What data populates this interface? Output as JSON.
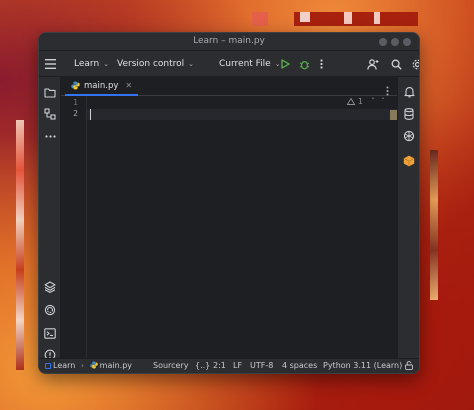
{
  "window": {
    "title": "Learn – main.py"
  },
  "toolbar": {
    "project": "Learn",
    "vcs": "Version control",
    "run_config": "Current File"
  },
  "tabs": [
    {
      "label": "main.py"
    }
  ],
  "editor": {
    "line_numbers": [
      "1",
      "2"
    ],
    "current_line": 2,
    "inspection_count": "1"
  },
  "status_bar": {
    "breadcrumb_project": "Learn",
    "breadcrumb_file": "main.py",
    "plugin": "Sourcery",
    "json_indicator": "{..}",
    "position": "2:1",
    "line_ending": "LF",
    "encoding": "UTF-8",
    "indent": "4 spaces",
    "interpreter": "Python 3.11 (Learn)"
  },
  "icons": {
    "left_bar": [
      "folder-icon",
      "structure-icon",
      "more-icon",
      "layers-icon",
      "python-packages-icon",
      "terminal-icon",
      "problems-icon",
      "git-icon"
    ],
    "right_bar": [
      "notifications-icon",
      "database-icon",
      "ai-assistant-icon",
      "plugin-cube-icon"
    ]
  },
  "colors": {
    "accent": "#3574f0",
    "run_green": "#57a64a",
    "plugin_orange": "#f0a23b"
  }
}
